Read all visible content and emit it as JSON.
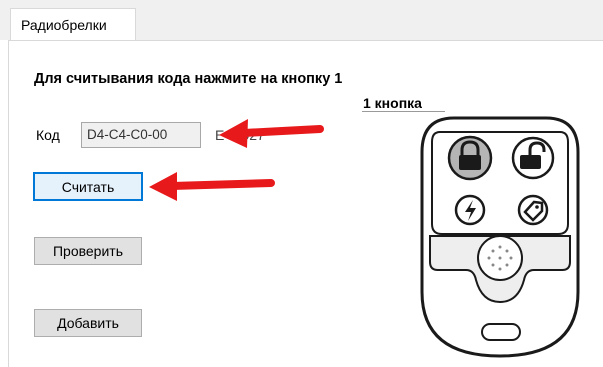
{
  "tabs": [
    {
      "label": "Радиобрелки"
    }
  ],
  "form": {
    "heading": "Для считывания кода нажмите на кнопку 1",
    "code_label": "Код",
    "code_value": "D4-C4-C0-00",
    "code_extra": "E-0-027",
    "read_button": "Считать",
    "check_button": "Проверить",
    "add_button": "Добавить"
  },
  "remote": {
    "button_label": "1 кнопка",
    "buttons": [
      "lock-icon",
      "unlock-icon",
      "lightning-icon",
      "tag-icon"
    ]
  },
  "annotations": {
    "arrow_color": "#e8191b"
  }
}
